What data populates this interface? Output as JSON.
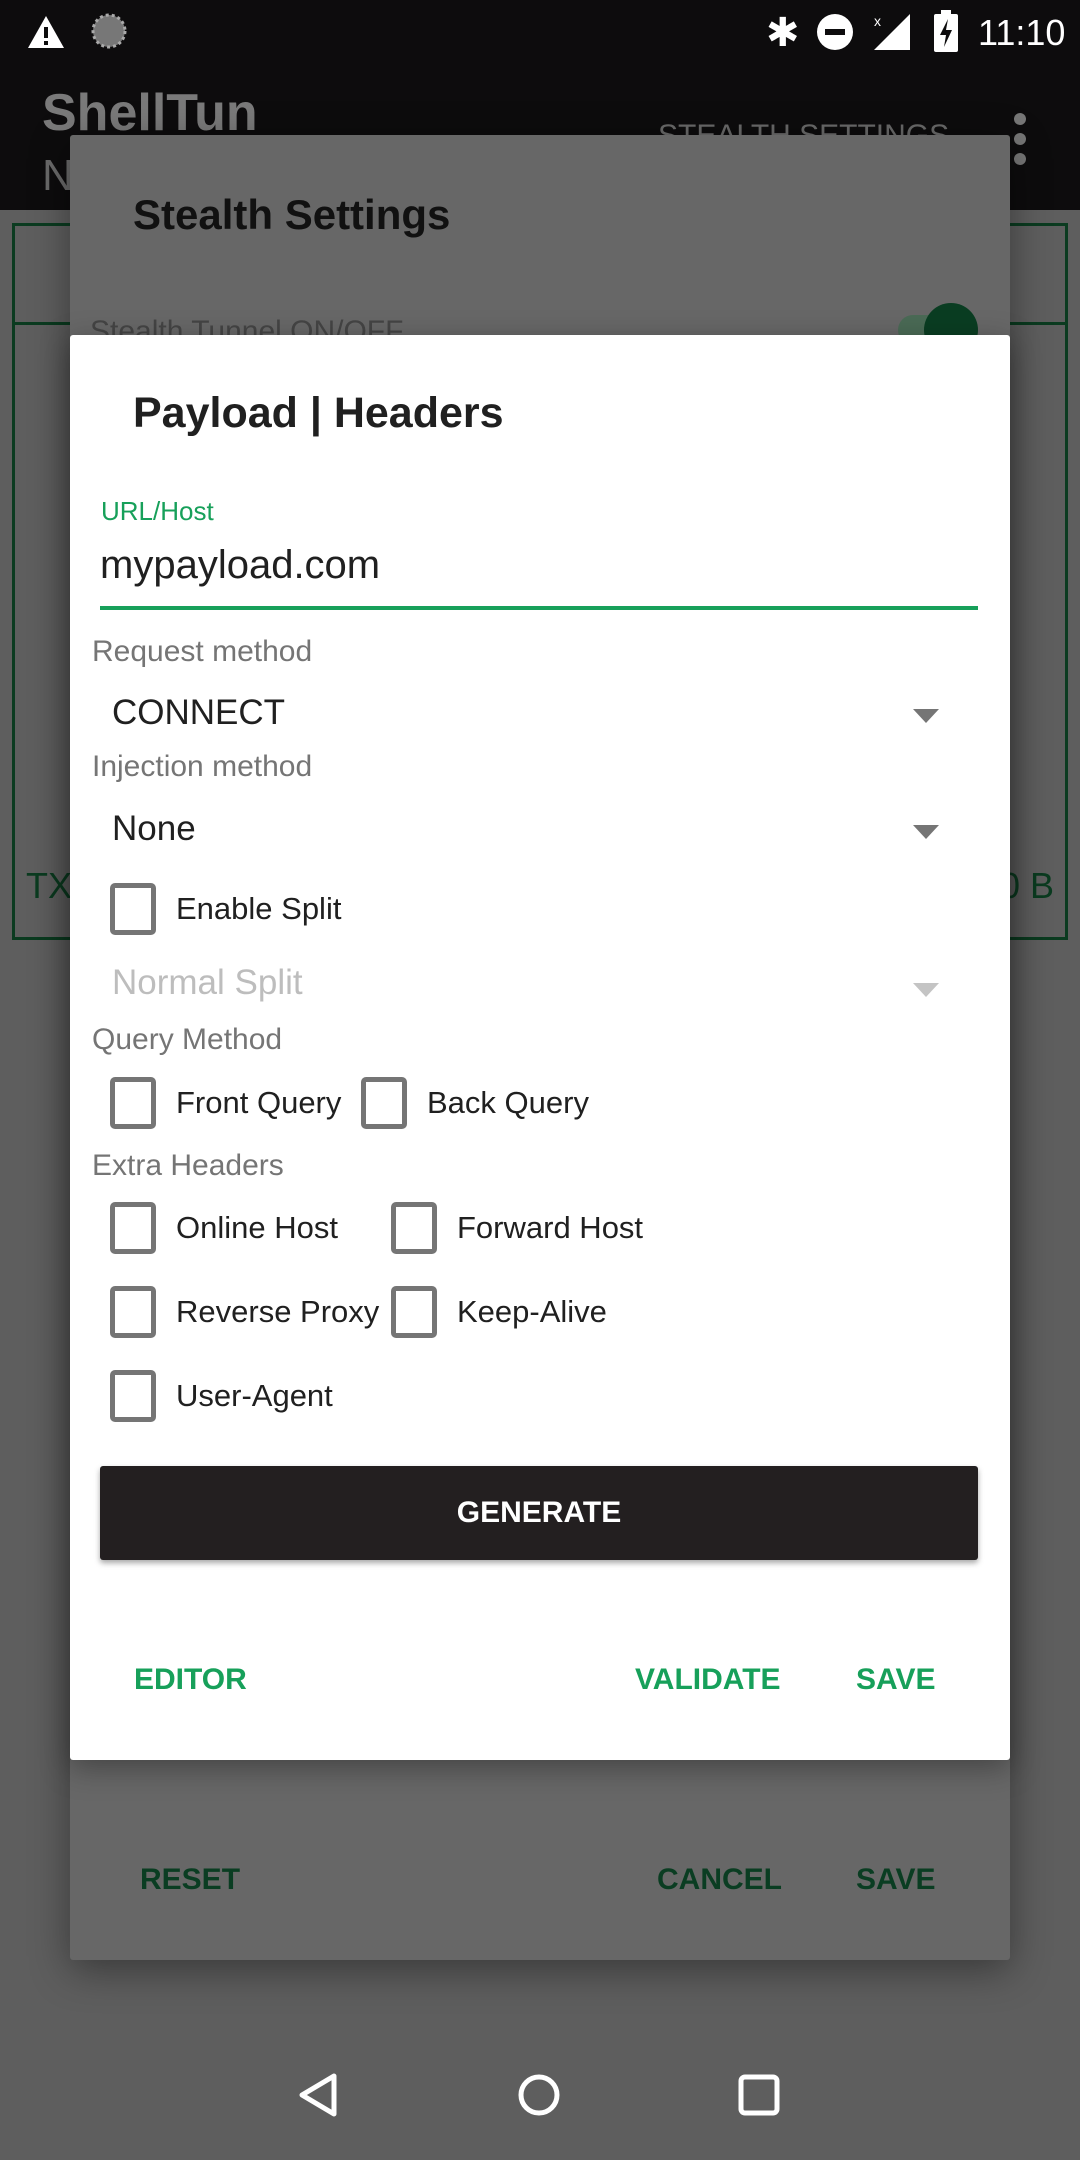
{
  "status_bar": {
    "time": "11:10",
    "icons": [
      "warning-icon",
      "sync-icon",
      "bluetooth-icon",
      "do-not-disturb-icon",
      "no-signal-icon",
      "battery-charging-icon"
    ]
  },
  "app_bar": {
    "title": "ShellTun",
    "subtitle_partial": "N",
    "action": "STEALTH SETTINGS"
  },
  "background": {
    "tx_label": "TX",
    "rx_value_partial": "0 B"
  },
  "stealth_dialog": {
    "title": "Stealth Settings",
    "toggle_label": "Stealth Tunnel ON/OFF",
    "toggle_on": true,
    "buttons": {
      "reset": "RESET",
      "cancel": "CANCEL",
      "save": "SAVE"
    }
  },
  "payload_dialog": {
    "title": "Payload | Headers",
    "url_label": "URL/Host",
    "url_value": "mypayload.com",
    "request_method_label": "Request method",
    "request_method": "CONNECT",
    "injection_method_label": "Injection method",
    "injection_method": "None",
    "enable_split": {
      "label": "Enable Split",
      "checked": false
    },
    "split_mode": "Normal Split",
    "query_method_label": "Query Method",
    "front_query": {
      "label": "Front Query",
      "checked": false
    },
    "back_query": {
      "label": "Back Query",
      "checked": false
    },
    "extra_headers_label": "Extra Headers",
    "online_host": {
      "label": "Online Host",
      "checked": false
    },
    "forward_host": {
      "label": "Forward Host",
      "checked": false
    },
    "reverse_proxy": {
      "label": "Reverse Proxy",
      "checked": false
    },
    "keep_alive": {
      "label": "Keep-Alive",
      "checked": false
    },
    "user_agent": {
      "label": "User-Agent",
      "checked": false
    },
    "generate": "GENERATE",
    "buttons": {
      "editor": "EDITOR",
      "validate": "VALIDATE",
      "save": "SAVE"
    }
  },
  "colors": {
    "accent": "#17a05a",
    "dark_accent": "#0a3d22",
    "button_dark": "#231f20"
  }
}
